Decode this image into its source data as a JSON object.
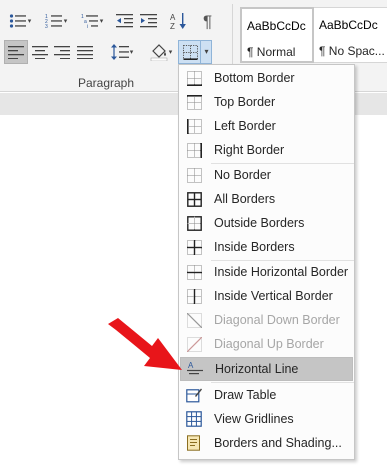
{
  "ribbon": {
    "group_label": "Paragraph",
    "styles": [
      {
        "sample": "AaBbCcDc",
        "name": "¶ Normal"
      },
      {
        "sample": "AaBbCcDc",
        "name": "¶ No Spac..."
      }
    ]
  },
  "icons": {
    "bullets": "bullets-icon",
    "numbering": "numbering-icon",
    "multilevel": "multilevel-list-icon",
    "decrease_indent": "decrease-indent-icon",
    "increase_indent": "increase-indent-icon",
    "sort": "sort-icon",
    "show_marks": "pilcrow-icon",
    "align_left": "align-left-icon",
    "center": "align-center-icon",
    "align_right": "align-right-icon",
    "justify": "justify-icon",
    "line_spacing": "line-spacing-icon",
    "shading": "shading-icon",
    "borders": "borders-icon"
  },
  "menu": {
    "items": [
      {
        "label": "Bottom Border",
        "icon": "bottom-border-icon"
      },
      {
        "label": "Top Border",
        "icon": "top-border-icon"
      },
      {
        "label": "Left Border",
        "icon": "left-border-icon"
      },
      {
        "label": "Right Border",
        "icon": "right-border-icon"
      },
      {
        "label": "No Border",
        "icon": "no-border-icon"
      },
      {
        "label": "All Borders",
        "icon": "all-borders-icon"
      },
      {
        "label": "Outside Borders",
        "icon": "outside-borders-icon"
      },
      {
        "label": "Inside Borders",
        "icon": "inside-borders-icon"
      },
      {
        "label": "Inside Horizontal Border",
        "icon": "inside-horizontal-border-icon"
      },
      {
        "label": "Inside Vertical Border",
        "icon": "inside-vertical-border-icon"
      },
      {
        "label": "Diagonal Down Border",
        "icon": "diagonal-down-border-icon"
      },
      {
        "label": "Diagonal Up Border",
        "icon": "diagonal-up-border-icon"
      },
      {
        "label": "Horizontal Line",
        "icon": "horizontal-line-icon"
      },
      {
        "label": "Draw Table",
        "icon": "draw-table-icon"
      },
      {
        "label": "View Gridlines",
        "icon": "view-gridlines-icon"
      },
      {
        "label": "Borders and Shading...",
        "icon": "borders-and-shading-icon"
      }
    ]
  },
  "colors": {
    "annotation_arrow": "#e8151a",
    "highlight": "#c5c5c5",
    "accent": "#2b579a"
  }
}
